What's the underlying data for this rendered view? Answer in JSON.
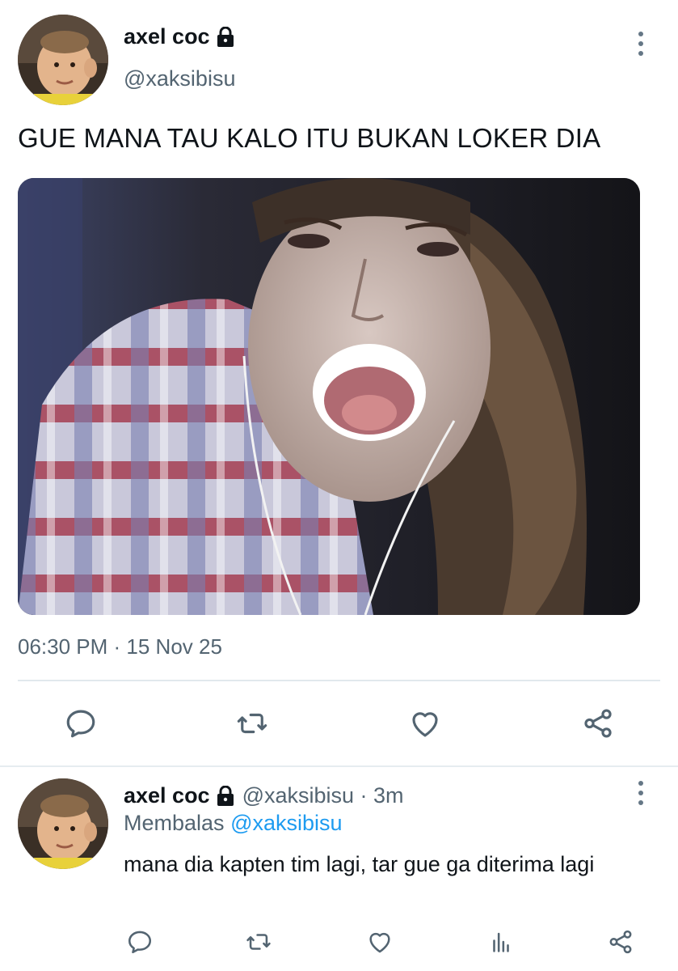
{
  "main_tweet": {
    "display_name": "axel coc",
    "handle": "@xaksibisu",
    "text": "GUE MANA TAU KALO ITU BUKAN LOKER DIA",
    "timestamp": "06:30 PM · 15 Nov 25",
    "icons": {
      "lock": "lock-icon",
      "more": "more-vertical-icon",
      "reply": "reply-icon",
      "retweet": "retweet-icon",
      "like": "heart-icon",
      "share": "share-icon"
    }
  },
  "reply_tweet": {
    "display_name": "axel coc",
    "handle_time": "@xaksibisu · 3m",
    "replying_prefix": "Membalas",
    "replying_mention": "@xaksibisu",
    "text": "mana dia kapten tim lagi, tar gue ga diterima lagi",
    "icons": {
      "reply": "reply-icon",
      "retweet": "retweet-icon",
      "like": "heart-icon",
      "stats": "stats-icon",
      "share": "share-icon"
    }
  },
  "colors": {
    "text_primary": "#0f1419",
    "text_secondary": "#536471",
    "link": "#1d9bf0",
    "icon": "#536471",
    "divider": "#e1e8ed"
  }
}
